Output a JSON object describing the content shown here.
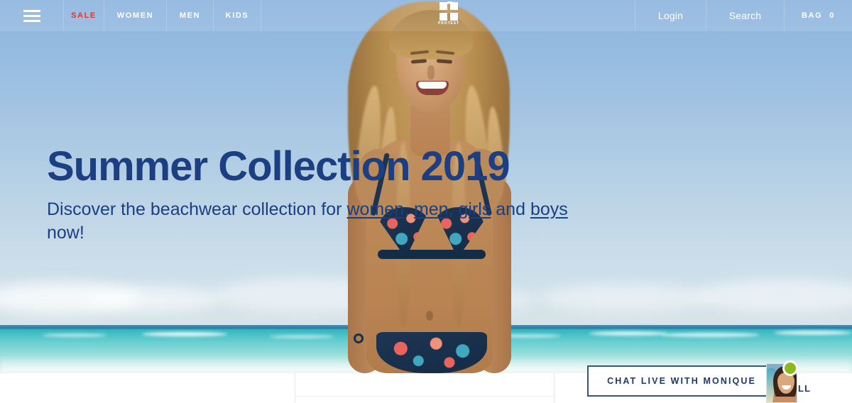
{
  "nav": {
    "menu_icon": "hamburger-menu-icon",
    "items": [
      {
        "label": "SALE",
        "accent": "#e8322d"
      },
      {
        "label": "WOMEN",
        "accent": "#ffffff"
      },
      {
        "label": "MEN",
        "accent": "#ffffff"
      },
      {
        "label": "KIDS",
        "accent": "#ffffff"
      }
    ],
    "login_label": "Login",
    "search_label": "Search",
    "bag_label": "BAG",
    "bag_count": "0"
  },
  "logo": {
    "wordmark": "PROTEST",
    "mark": "protest-cross-circle-logo"
  },
  "hero": {
    "title": "Summer Collection 2019",
    "subtitle_pre": "Discover the beachwear collection for ",
    "link_women": "women",
    "sep1": ", ",
    "link_men": "men",
    "sep2": ", ",
    "link_girls": "girls",
    "sep3": " and ",
    "link_boys": "boys",
    "subtitle_post": " now!",
    "text_color": "#1b3f82",
    "image_alt": "woman-in-floral-bikini-on-beach"
  },
  "chat": {
    "label": "CHAT LIVE WITH MONIQUE",
    "agent_name": "Monique",
    "status": "online",
    "status_color": "#8cb91c",
    "border_color": "#3a5573",
    "trailing_text": "LL"
  },
  "colors": {
    "sky_top": "#8db5de",
    "sky_bottom": "#d9e4e8",
    "sea": "#4cc3c9",
    "sale_red": "#e8322d",
    "headline_blue": "#1b3f82"
  }
}
